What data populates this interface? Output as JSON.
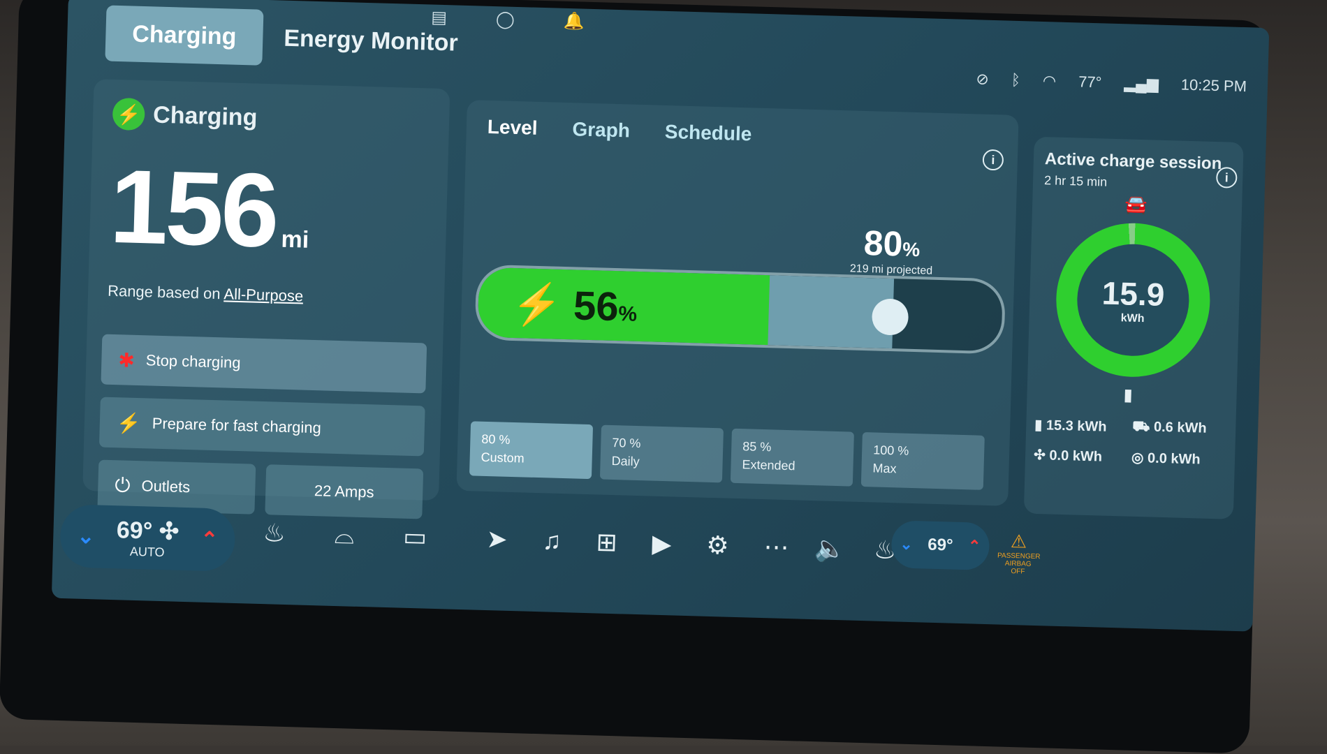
{
  "top_tabs": {
    "charging": "Charging",
    "energy": "Energy Monitor"
  },
  "status_bar": {
    "temperature": "77°",
    "time": "10:25 PM"
  },
  "left_panel": {
    "header": "Charging",
    "range_value": "156",
    "range_unit": "mi",
    "range_prefix": "Range based on",
    "range_link": "All-Purpose",
    "stop_button": "Stop charging",
    "prepare_button": "Prepare for fast charging",
    "outlets_button": "Outlets",
    "amps_button": "22 Amps"
  },
  "mid_panel": {
    "tabs": [
      "Level",
      "Graph",
      "Schedule"
    ],
    "current_pct": "56",
    "current_fraction": 0.56,
    "target_pct": "80",
    "target_fraction": 0.8,
    "pct_symbol": "%",
    "projected": "219 mi projected",
    "presets": [
      {
        "pct": "80 %",
        "label": "Custom"
      },
      {
        "pct": "70 %",
        "label": "Daily"
      },
      {
        "pct": "85 %",
        "label": "Extended"
      },
      {
        "pct": "100 %",
        "label": "Max"
      }
    ]
  },
  "right_panel": {
    "title": "Active charge session",
    "duration": "2 hr 15 min",
    "energy_value": "15.9",
    "energy_unit": "kWh",
    "stats": [
      {
        "icon": "battery-icon",
        "value": "15.3 kWh"
      },
      {
        "icon": "car-icon",
        "value": "0.6 kWh"
      },
      {
        "icon": "fan-icon",
        "value": "0.0 kWh"
      },
      {
        "icon": "steering-icon",
        "value": "0.0 kWh"
      }
    ]
  },
  "dock": {
    "driver_temp": "69°",
    "driver_mode": "AUTO",
    "passenger_temp": "69°",
    "airbag_text": "PASSENGER AIRBAG OFF"
  },
  "colors": {
    "accent_green": "#2fcf2f",
    "limit_blue": "#6f9eae"
  }
}
